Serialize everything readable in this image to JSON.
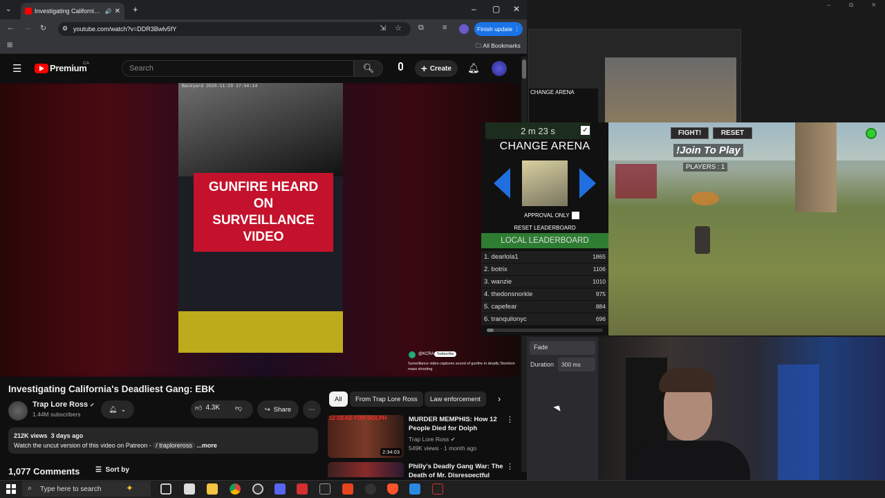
{
  "browser": {
    "tab_title": "Investigating California's De",
    "url": "youtube.com/watch?v=DDR3Bwlv5fY",
    "finish_update": "Finish update",
    "all_bookmarks": "All Bookmarks"
  },
  "youtube": {
    "logo": "Premium",
    "logo_region": "CA",
    "search_placeholder": "Search",
    "create_label": "Create",
    "overlay_timestamp": "Backyard 2025-11-29 17:50:14",
    "overlay_headline": "GUNFIRE HEARD ON SURVEILLANCE VIDEO",
    "overlay_source": "@KCRA",
    "overlay_subscribe": "Subscribe",
    "overlay_caption": "Surveillance video captures sound of gunfire in deadly Stockton mass shooting",
    "title": "Investigating California's Deadliest Gang: EBK",
    "channel": "Trap Lore Ross",
    "subscribers": "1.44M subscribers",
    "likes": "4.3K",
    "share": "Share",
    "views": "212K views",
    "date": "3 days ago",
    "description": "Watch the uncut version of this video on Patreon -",
    "description_link": "/ traploreross",
    "more": "...more",
    "comments_count": "1,077 Comments",
    "sort_by": "Sort by",
    "chips": [
      "All",
      "From Trap Lore Ross",
      "Law enforcement"
    ],
    "recommendations": [
      {
        "title": "MURDER MEMPHIS: How 12 People Died for Dolph",
        "channel": "Trap Lore Ross",
        "meta": "549K views · 1 month ago",
        "duration": "2:34:03",
        "thumb_text": "12 DEAD FOR DOLPH"
      },
      {
        "title": "Philly's Deadly Gang War: The Death of Mr. Disrespectful",
        "channel": "",
        "meta": "",
        "duration": "",
        "thumb_text": ""
      }
    ]
  },
  "game": {
    "timer": "2 m 23 s",
    "change_arena": "CHANGE ARENA",
    "approval_only": "APPROVAL ONLY",
    "reset_leaderboard": "RESET LEADERBOARD",
    "local_leaderboard": "LOCAL LEADERBOARD",
    "fight": "FIGHT!",
    "reset": "RESET",
    "join": "!Join To Play",
    "players": "PLAYERS : 1",
    "leaderboard": [
      {
        "name": "1. dearlola1",
        "score": "1865"
      },
      {
        "name": "2. botrix",
        "score": "1106"
      },
      {
        "name": "3. wanzie",
        "score": "1010"
      },
      {
        "name": "4. thedonsnorkle",
        "score": "975"
      },
      {
        "name": "5. capefear",
        "score": "884"
      },
      {
        "name": "6. tranquilonyc",
        "score": "696"
      }
    ]
  },
  "obs": {
    "fade": "Fade",
    "duration_label": "Duration",
    "duration_value": "300 ms"
  },
  "taskbar": {
    "search_placeholder": "Type here to search"
  },
  "colors": {
    "yt_red": "#ff0000",
    "leaderboard_green": "#2e7d32",
    "accent_blue": "#1a73e8"
  }
}
